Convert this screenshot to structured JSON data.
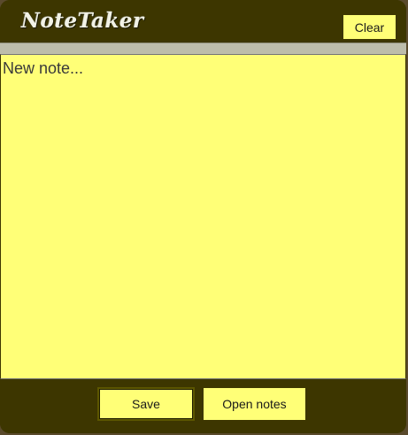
{
  "app": {
    "title": "NoteTaker"
  },
  "toolbar": {
    "clear_label": "Clear"
  },
  "note": {
    "placeholder": "New note...",
    "value": ""
  },
  "footer": {
    "save_label": "Save",
    "open_notes_label": "Open notes"
  },
  "colors": {
    "window_background": "#3d3600",
    "note_background": "#ffff77",
    "button_background": "#ffff77",
    "divider": "#bdbdab",
    "title_text": "#f2f2e6"
  }
}
